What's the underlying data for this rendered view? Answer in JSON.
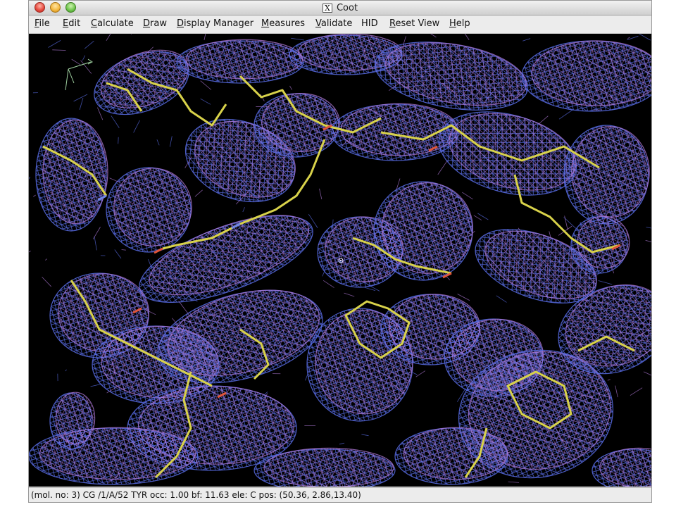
{
  "window": {
    "title": "Coot",
    "x_icon_glyph": "X"
  },
  "menu": [
    {
      "label": "File",
      "mnemonic": "F",
      "rest": "ile"
    },
    {
      "label": "Edit",
      "mnemonic": "E",
      "rest": "dit"
    },
    {
      "label": "Calculate",
      "mnemonic": "C",
      "rest": "alculate"
    },
    {
      "label": "Draw",
      "mnemonic": "D",
      "rest": "raw"
    },
    {
      "label": "Display Manager",
      "mnemonic": "D",
      "rest": "isplay Manager"
    },
    {
      "label": "Measures",
      "mnemonic": "M",
      "rest": "easures"
    },
    {
      "label": "Validate",
      "mnemonic": "V",
      "rest": "alidate"
    },
    {
      "label": "HID",
      "mnemonic": "",
      "rest": "HID"
    },
    {
      "label": "Reset View",
      "mnemonic": "R",
      "rest": "eset View"
    },
    {
      "label": "Help",
      "mnemonic": "H",
      "rest": "elp"
    }
  ],
  "viewport": {
    "description_icons": [
      "axes-icon",
      "rotation-centre-icon"
    ],
    "colors": {
      "background": "#000000",
      "density_map_a": "#5a6ee8",
      "density_map_b": "#b07ad8",
      "model_carbon": "#d8d24a",
      "model_oxygen": "#e0553a",
      "model_nitrogen": "#6f86e6"
    }
  },
  "status": {
    "text": "(mol. no: 3)  CG /1/A/52 TYR occ:  1.00 bf: 11.63 ele:  C pos: (50.36, 2.86,13.40)"
  }
}
